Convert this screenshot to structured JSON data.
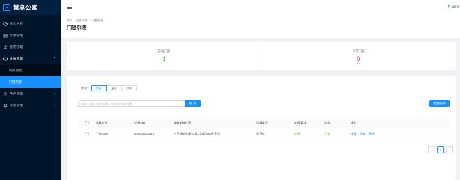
{
  "app": {
    "title": "慧享公寓",
    "logo_letter": "H",
    "brand_color": "#1890ff"
  },
  "sidebar": {
    "items": [
      {
        "label": "统计分析",
        "icon": "chart-icon",
        "has_children": false
      },
      {
        "label": "房源管理",
        "icon": "building-icon",
        "has_children": false
      },
      {
        "label": "租客管理",
        "icon": "person-icon",
        "has_children": true
      },
      {
        "label": "设备管理",
        "icon": "monitor-icon",
        "has_children": true,
        "open": true
      },
      {
        "label": "用户管理",
        "icon": "user-icon",
        "has_children": true
      },
      {
        "label": "消息管理",
        "icon": "bell-icon",
        "has_children": true
      }
    ],
    "sub_items": [
      {
        "label": "网关管理",
        "active": false
      },
      {
        "label": "门锁列表",
        "active": true
      }
    ]
  },
  "header": {
    "user_name": "lasha"
  },
  "breadcrumb": {
    "home": "首页",
    "section": "设备管理",
    "current": "门锁列表",
    "separator": "/"
  },
  "page": {
    "title": "门锁列表"
  },
  "stats": {
    "online_label": "在线门锁",
    "online_value": "1",
    "online_color": "#52c41a",
    "abnormal_label": "异常门锁",
    "abnormal_value": "0",
    "abnormal_color": "#f5222d"
  },
  "filter": {
    "label": "状态:",
    "options": [
      "全部",
      "正常",
      "异常"
    ],
    "selected": "全部"
  },
  "search": {
    "placeholder": "请输入设备名称/设备MAC/安装关联位置",
    "value": "",
    "button_label": "搜 索"
  },
  "batch_delete_label": "批量删除",
  "table": {
    "columns": [
      "设备名称",
      "设备mac",
      "关联安装位置",
      "设备类型",
      "在线/离线",
      "状态",
      "操作"
    ],
    "rows": [
      {
        "name": "门锁001d",
        "mac": "80aaeaa000f1d",
        "location": "拉贡智能公寓/公寓1号楼/801/卧室房",
        "type": "蓝牙锁",
        "online": "在线",
        "status": "正常",
        "actions": [
          "详情",
          "关联",
          "删除"
        ]
      }
    ]
  },
  "pagination": {
    "prev": "‹",
    "current": "1",
    "next": "›"
  }
}
